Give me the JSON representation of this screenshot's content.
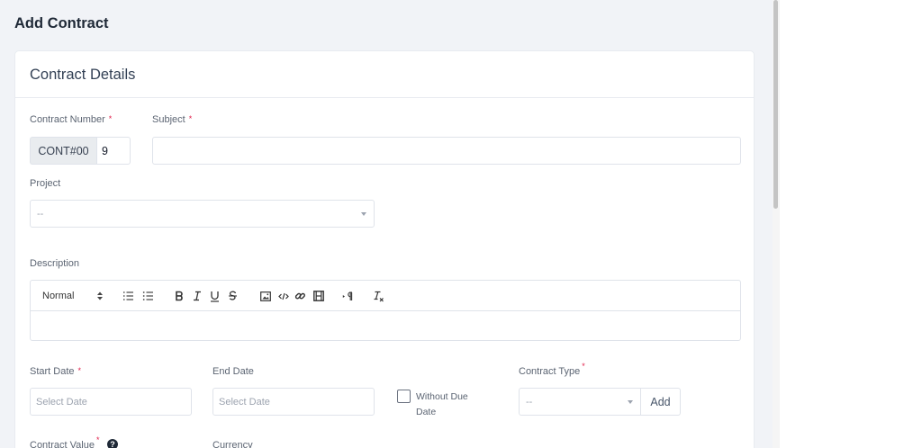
{
  "page": {
    "title": "Add Contract"
  },
  "card": {
    "title": "Contract Details"
  },
  "form": {
    "contract_number": {
      "label": "Contract Number",
      "prefix": "CONT#00",
      "value": "9"
    },
    "subject": {
      "label": "Subject",
      "value": ""
    },
    "project": {
      "label": "Project",
      "selected": "--"
    },
    "description": {
      "label": "Description",
      "toolbar": {
        "format": "Normal"
      }
    },
    "start_date": {
      "label": "Start Date",
      "placeholder": "Select Date"
    },
    "end_date": {
      "label": "End Date",
      "placeholder": "Select Date"
    },
    "without_due_date": {
      "label_line1": "Without Due",
      "label_line2": "Date",
      "checked": false
    },
    "contract_type": {
      "label": "Contract Type",
      "selected": "--",
      "add_label": "Add"
    },
    "contract_value": {
      "label": "Contract Value"
    },
    "currency": {
      "label": "Currency"
    }
  },
  "colors": {
    "required": "#e11d48",
    "background": "#f1f3f7",
    "card": "#ffffff"
  }
}
